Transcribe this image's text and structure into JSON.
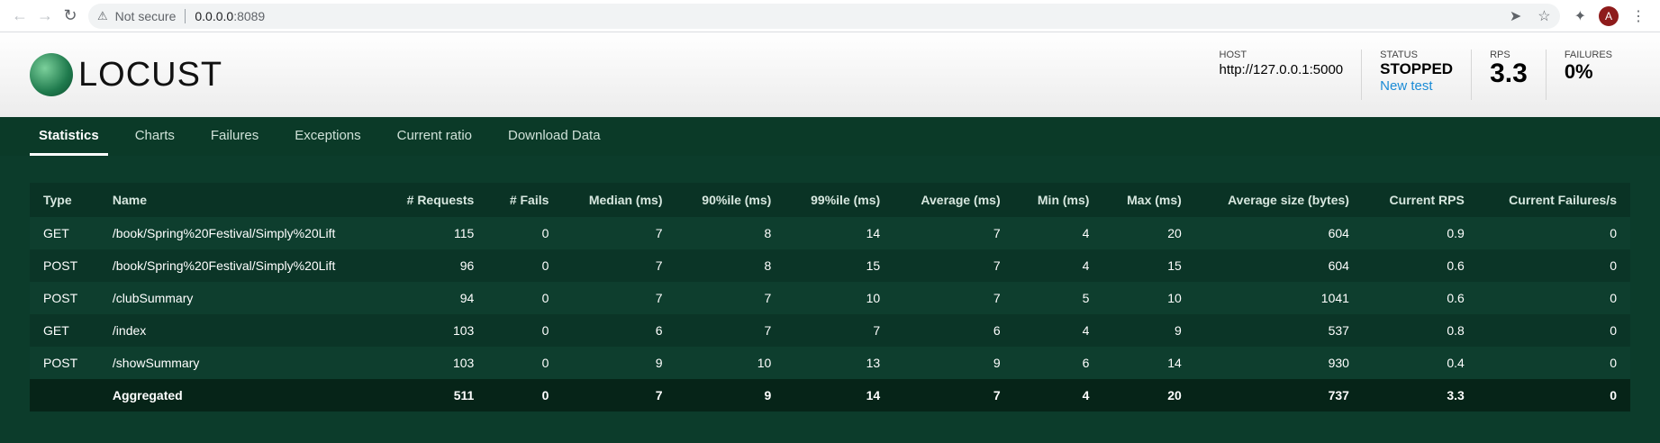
{
  "browser": {
    "security_label": "Not secure",
    "url_host": "0.0.0.0",
    "url_port": ":8089",
    "avatar_letter": "A"
  },
  "app": {
    "logo_text": "LOCUST",
    "host_label": "HOST",
    "host_value": "http://127.0.0.1:5000",
    "status_label": "STATUS",
    "status_value": "STOPPED",
    "new_test_label": "New test",
    "rps_label": "RPS",
    "rps_value": "3.3",
    "failures_label": "FAILURES",
    "failures_value": "0%"
  },
  "tabs": [
    {
      "label": "Statistics",
      "active": true
    },
    {
      "label": "Charts"
    },
    {
      "label": "Failures"
    },
    {
      "label": "Exceptions"
    },
    {
      "label": "Current ratio"
    },
    {
      "label": "Download Data"
    }
  ],
  "table": {
    "headers": [
      "Type",
      "Name",
      "# Requests",
      "# Fails",
      "Median (ms)",
      "90%ile (ms)",
      "99%ile (ms)",
      "Average (ms)",
      "Min (ms)",
      "Max (ms)",
      "Average size (bytes)",
      "Current RPS",
      "Current Failures/s"
    ],
    "rows": [
      [
        "GET",
        "/book/Spring%20Festival/Simply%20Lift",
        "115",
        "0",
        "7",
        "8",
        "14",
        "7",
        "4",
        "20",
        "604",
        "0.9",
        "0"
      ],
      [
        "POST",
        "/book/Spring%20Festival/Simply%20Lift",
        "96",
        "0",
        "7",
        "8",
        "15",
        "7",
        "4",
        "15",
        "604",
        "0.6",
        "0"
      ],
      [
        "POST",
        "/clubSummary",
        "94",
        "0",
        "7",
        "7",
        "10",
        "7",
        "5",
        "10",
        "1041",
        "0.6",
        "0"
      ],
      [
        "GET",
        "/index",
        "103",
        "0",
        "6",
        "7",
        "7",
        "6",
        "4",
        "9",
        "537",
        "0.8",
        "0"
      ],
      [
        "POST",
        "/showSummary",
        "103",
        "0",
        "9",
        "10",
        "13",
        "9",
        "6",
        "14",
        "930",
        "0.4",
        "0"
      ]
    ],
    "aggregate": [
      "",
      "Aggregated",
      "511",
      "0",
      "7",
      "9",
      "14",
      "7",
      "4",
      "20",
      "737",
      "3.3",
      "0"
    ]
  }
}
